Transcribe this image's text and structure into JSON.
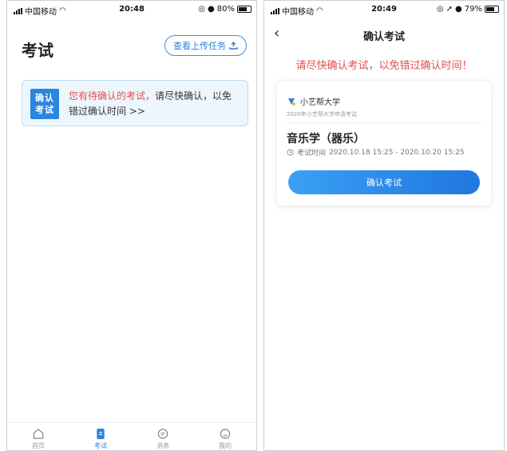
{
  "screen1": {
    "status": {
      "carrier": "中国移动",
      "time": "20:48",
      "battery": "80%"
    },
    "title": "考试",
    "upload_button": "查看上传任务",
    "notice": {
      "badge_line1": "确认",
      "badge_line2": "考试",
      "text_red": "您有待确认的考试，",
      "text_rest": "请尽快确认，以免错过确认时间 >>"
    },
    "tabs": [
      {
        "icon": "home-icon",
        "label": "首页"
      },
      {
        "icon": "exam-icon",
        "label": "考试"
      },
      {
        "icon": "message-icon",
        "label": "消息"
      },
      {
        "icon": "profile-icon",
        "label": "我的"
      }
    ]
  },
  "screen2": {
    "status": {
      "carrier": "中国移动",
      "time": "20:49",
      "battery": "79%"
    },
    "title": "确认考试",
    "warning": "请尽快确认考试，以免错过确认时间！",
    "card": {
      "school": "小艺帮大学",
      "subtitle": "2020年小艺帮大学申请考试",
      "exam_name": "音乐学（器乐）",
      "exam_time_label": "考试时间",
      "exam_time": "2020.10.18 15:25 - 2020.10.20 15:25",
      "confirm_button": "确认考试"
    }
  },
  "colors": {
    "accent": "#2b86e0",
    "warning": "#e0524f"
  }
}
